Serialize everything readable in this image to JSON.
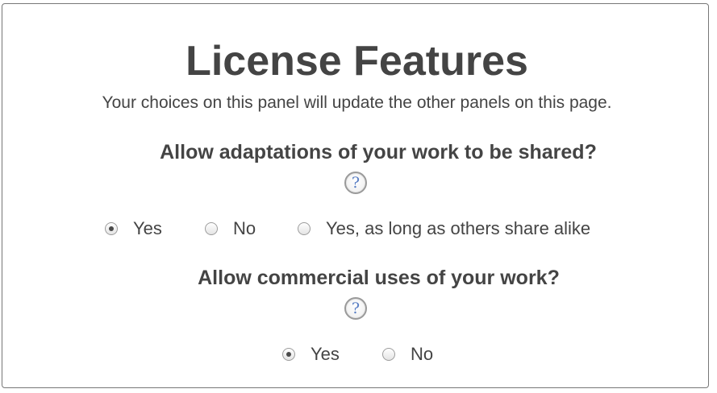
{
  "panel": {
    "title": "License Features",
    "subtitle": "Your choices on this panel will update the other panels on this page."
  },
  "adaptations": {
    "question": "Allow adaptations of your work to be shared?",
    "help": "?",
    "options": [
      {
        "label": "Yes",
        "checked": true
      },
      {
        "label": "No",
        "checked": false
      },
      {
        "label": "Yes, as long as others share alike",
        "checked": false
      }
    ]
  },
  "commercial": {
    "question": "Allow commercial uses of your work?",
    "help": "?",
    "options": [
      {
        "label": "Yes",
        "checked": true
      },
      {
        "label": "No",
        "checked": false
      }
    ]
  }
}
